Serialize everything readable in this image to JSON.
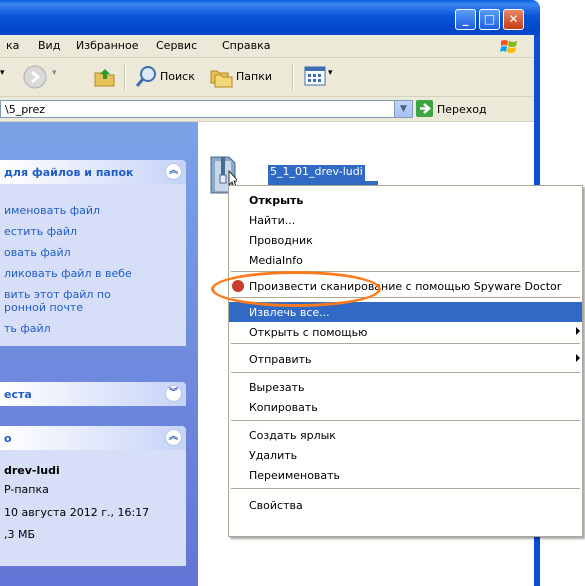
{
  "menubar": {
    "items": [
      "ка",
      "Вид",
      "Избранное",
      "Сервис",
      "Справка"
    ]
  },
  "toolbar": {
    "search_label": "Поиск",
    "folders_label": "Папки"
  },
  "addressbar": {
    "value": "\\5_prez",
    "go_label": "Переход"
  },
  "tasks_panel": {
    "title": "для файлов и папок",
    "items": [
      "именовать файл",
      "естить файл",
      "овать файл",
      "ликовать файл в вебе",
      "вить этот файл по",
      "ронной почте",
      "ть файл"
    ]
  },
  "places_panel": {
    "title": "еста"
  },
  "details_panel": {
    "title": "о",
    "name": "drev-ludi",
    "type": "P-папка",
    "date": "10 августа 2012 г., 16:17",
    "size": ",3 МБ"
  },
  "file": {
    "name": "5_1_01_drev-ludi"
  },
  "context_menu": {
    "open": "Открыть",
    "find": "Найти...",
    "explorer": "Проводник",
    "mediainfo": "MediaInfo",
    "spyware": "Произвести сканирование с помощью Spyware Doctor",
    "extract": "Извлечь все...",
    "open_with": "Открыть с помощью",
    "send_to": "Отправить",
    "cut": "Вырезать",
    "copy": "Копировать",
    "shortcut": "Создать ярлык",
    "delete": "Удалить",
    "rename": "Переименовать",
    "properties": "Свойства"
  },
  "colors": {
    "titlebar": "#0a55d8",
    "highlight": "#316ac5",
    "annotation": "#ff7a1a",
    "taskpane": "#7ba2e7"
  }
}
